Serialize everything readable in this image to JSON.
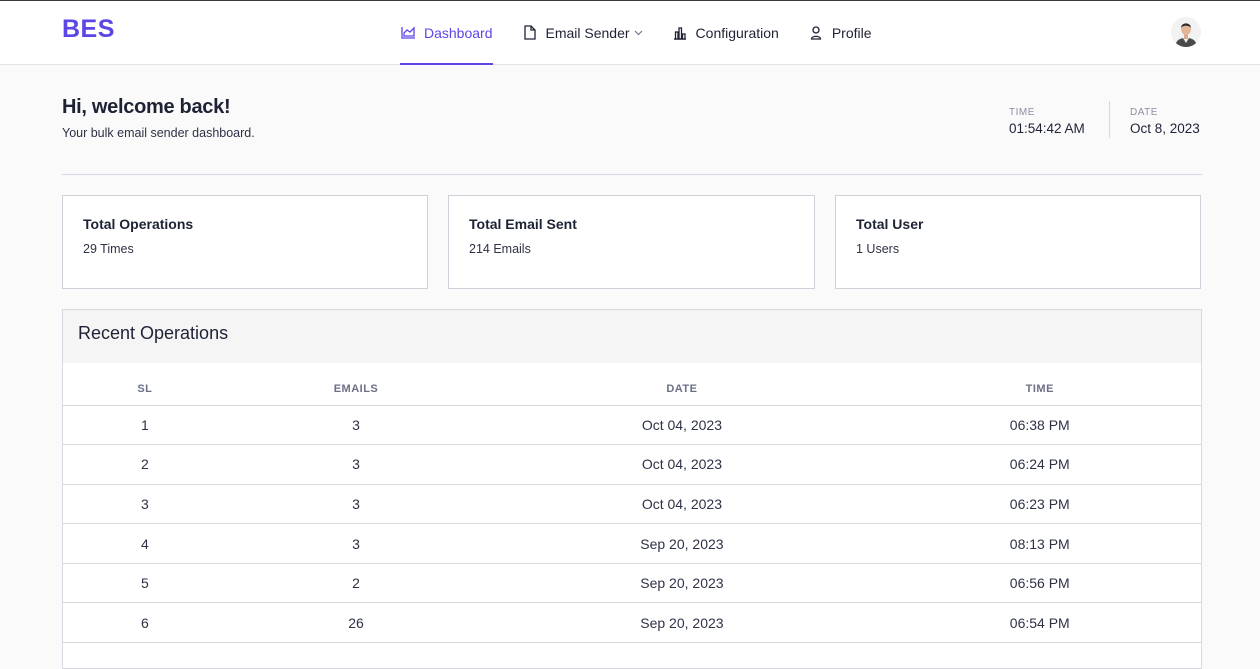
{
  "brand": {
    "logo": "BES",
    "accent_color": "#5b46e6"
  },
  "nav": {
    "items": [
      {
        "label": "Dashboard",
        "icon": "chart-area-icon",
        "active": true
      },
      {
        "label": "Email Sender",
        "icon": "document-icon",
        "dropdown": true
      },
      {
        "label": "Configuration",
        "icon": "bar-chart-icon"
      },
      {
        "label": "Profile",
        "icon": "user-icon"
      }
    ],
    "avatar": "user-avatar"
  },
  "welcome": {
    "title": "Hi, welcome back!",
    "subtitle": "Your bulk email sender dashboard."
  },
  "clock": {
    "time_label": "TIME",
    "time_value": "01:54:42 AM",
    "date_label": "DATE",
    "date_value": "Oct 8, 2023"
  },
  "stats": [
    {
      "title": "Total Operations",
      "value": "29 Times"
    },
    {
      "title": "Total Email Sent",
      "value": "214 Emails"
    },
    {
      "title": "Total User",
      "value": "1 Users"
    }
  ],
  "recent": {
    "title": "Recent Operations",
    "columns": [
      "SL",
      "EMAILS",
      "DATE",
      "TIME"
    ],
    "rows": [
      [
        "1",
        "3",
        "Oct 04, 2023",
        "06:38 PM"
      ],
      [
        "2",
        "3",
        "Oct 04, 2023",
        "06:24 PM"
      ],
      [
        "3",
        "3",
        "Oct 04, 2023",
        "06:23 PM"
      ],
      [
        "4",
        "3",
        "Sep 20, 2023",
        "08:13 PM"
      ],
      [
        "5",
        "2",
        "Sep 20, 2023",
        "06:56 PM"
      ],
      [
        "6",
        "26",
        "Sep 20, 2023",
        "06:54 PM"
      ]
    ]
  }
}
